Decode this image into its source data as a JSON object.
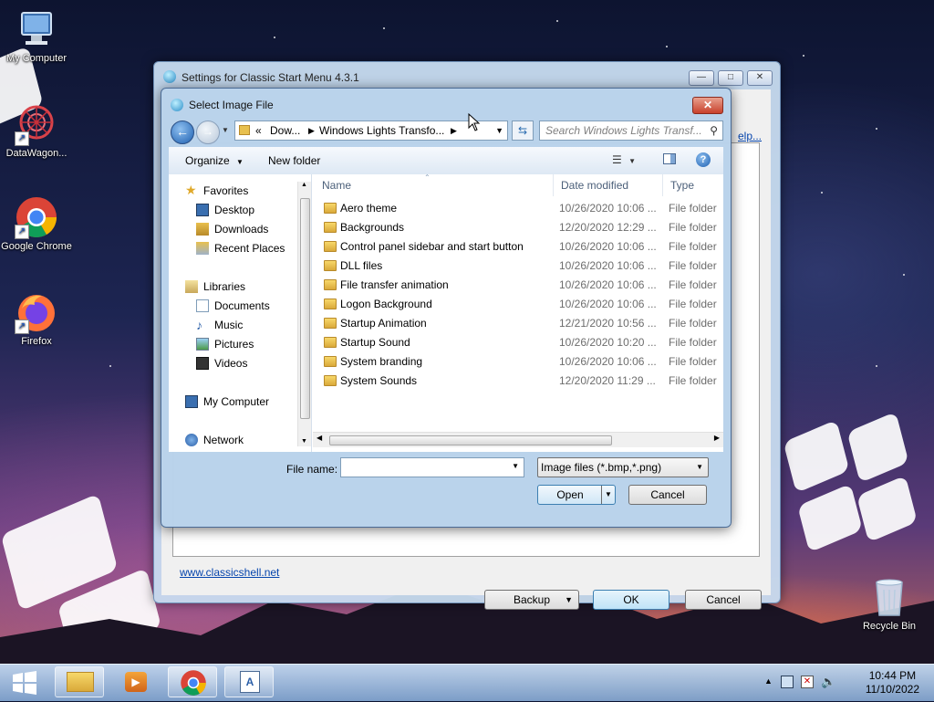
{
  "desktop": {
    "icons": [
      {
        "label": "My Computer"
      },
      {
        "label": "DataWagon..."
      },
      {
        "label": "Google Chrome"
      },
      {
        "label": "Firefox"
      },
      {
        "label": "Recycle Bin"
      }
    ]
  },
  "settings_window": {
    "title": "Settings for Classic Start Menu 4.3.1",
    "help_link": "elp...",
    "website_link": "www.classicshell.net",
    "backup_label": "Backup",
    "ok_label": "OK",
    "cancel_label": "Cancel"
  },
  "dialog": {
    "title": "Select Image File",
    "address": {
      "prefix": "«",
      "crumbs": [
        "Dow...",
        "Windows Lights Transfo..."
      ]
    },
    "search_placeholder": "Search Windows Lights Transf...",
    "toolbar": {
      "organize": "Organize",
      "new_folder": "New folder"
    },
    "nav": {
      "favorites": "Favorites",
      "desktop": "Desktop",
      "downloads": "Downloads",
      "recent": "Recent Places",
      "libraries": "Libraries",
      "documents": "Documents",
      "music": "Music",
      "pictures": "Pictures",
      "videos": "Videos",
      "computer": "My Computer",
      "network": "Network"
    },
    "columns": {
      "name": "Name",
      "date": "Date modified",
      "type": "Type"
    },
    "files": [
      {
        "name": "Aero theme",
        "date": "10/26/2020 10:06 ...",
        "type": "File folder"
      },
      {
        "name": "Backgrounds",
        "date": "12/20/2020 12:29 ...",
        "type": "File folder"
      },
      {
        "name": "Control panel sidebar and start button",
        "date": "10/26/2020 10:06 ...",
        "type": "File folder"
      },
      {
        "name": "DLL files",
        "date": "10/26/2020 10:06 ...",
        "type": "File folder"
      },
      {
        "name": "File transfer animation",
        "date": "10/26/2020 10:06 ...",
        "type": "File folder"
      },
      {
        "name": "Logon Background",
        "date": "10/26/2020 10:06 ...",
        "type": "File folder"
      },
      {
        "name": "Startup Animation",
        "date": "12/21/2020 10:56 ...",
        "type": "File folder"
      },
      {
        "name": "Startup Sound",
        "date": "10/26/2020 10:20 ...",
        "type": "File folder"
      },
      {
        "name": "System branding",
        "date": "10/26/2020 10:06 ...",
        "type": "File folder"
      },
      {
        "name": "System Sounds",
        "date": "12/20/2020 11:29 ...",
        "type": "File folder"
      }
    ],
    "file_name_label": "File name:",
    "file_name_value": "",
    "file_type": "Image files (*.bmp,*.png)",
    "open_label": "Open",
    "cancel_label": "Cancel"
  },
  "taskbar": {
    "time": "10:44 PM",
    "date": "11/10/2022"
  }
}
